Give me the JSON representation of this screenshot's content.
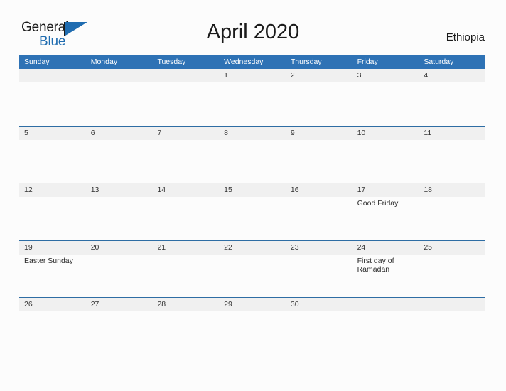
{
  "brand": {
    "name_part1": "General",
    "name_part2": "Blue",
    "flag_icon": "flag-triangle-icon",
    "accent_color": "#1f6cb0"
  },
  "header": {
    "title": "April 2020",
    "country": "Ethiopia"
  },
  "theme": {
    "header_blue": "#2e72b5",
    "divider_blue": "#2e6da4",
    "band_gray": "#f0f0f0",
    "page_background": "#fcfcfc",
    "text_color": "#333333"
  },
  "calendar": {
    "weekdays": [
      "Sunday",
      "Monday",
      "Tuesday",
      "Wednesday",
      "Thursday",
      "Friday",
      "Saturday"
    ],
    "weeks": [
      [
        {
          "day": "",
          "event": ""
        },
        {
          "day": "",
          "event": ""
        },
        {
          "day": "",
          "event": ""
        },
        {
          "day": "1",
          "event": ""
        },
        {
          "day": "2",
          "event": ""
        },
        {
          "day": "3",
          "event": ""
        },
        {
          "day": "4",
          "event": ""
        }
      ],
      [
        {
          "day": "5",
          "event": ""
        },
        {
          "day": "6",
          "event": ""
        },
        {
          "day": "7",
          "event": ""
        },
        {
          "day": "8",
          "event": ""
        },
        {
          "day": "9",
          "event": ""
        },
        {
          "day": "10",
          "event": ""
        },
        {
          "day": "11",
          "event": ""
        }
      ],
      [
        {
          "day": "12",
          "event": ""
        },
        {
          "day": "13",
          "event": ""
        },
        {
          "day": "14",
          "event": ""
        },
        {
          "day": "15",
          "event": ""
        },
        {
          "day": "16",
          "event": ""
        },
        {
          "day": "17",
          "event": "Good Friday"
        },
        {
          "day": "18",
          "event": ""
        }
      ],
      [
        {
          "day": "19",
          "event": "Easter Sunday"
        },
        {
          "day": "20",
          "event": ""
        },
        {
          "day": "21",
          "event": ""
        },
        {
          "day": "22",
          "event": ""
        },
        {
          "day": "23",
          "event": ""
        },
        {
          "day": "24",
          "event": "First day of Ramadan"
        },
        {
          "day": "25",
          "event": ""
        }
      ],
      [
        {
          "day": "26",
          "event": ""
        },
        {
          "day": "27",
          "event": ""
        },
        {
          "day": "28",
          "event": ""
        },
        {
          "day": "29",
          "event": ""
        },
        {
          "day": "30",
          "event": ""
        },
        {
          "day": "",
          "event": ""
        },
        {
          "day": "",
          "event": ""
        }
      ]
    ]
  }
}
